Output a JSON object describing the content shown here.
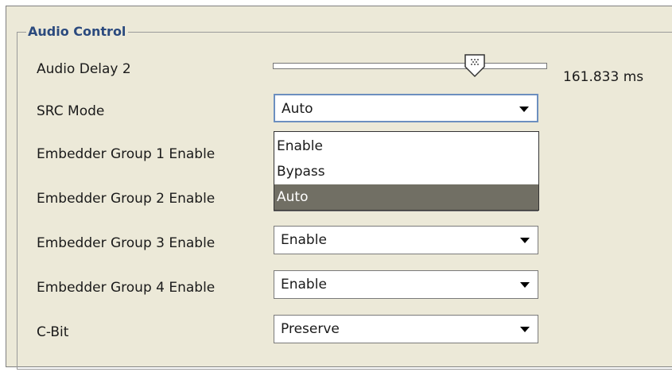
{
  "group_title": "Audio Control",
  "audio_delay": {
    "label": "Audio Delay 2",
    "value_text": "161.833 ms",
    "position": 0.73
  },
  "rows": [
    {
      "key": "src",
      "label": "SRC Mode",
      "value": "Auto"
    },
    {
      "key": "emb1",
      "label": "Embedder Group 1 Enable",
      "value": ""
    },
    {
      "key": "emb2",
      "label": "Embedder Group 2 Enable",
      "value": ""
    },
    {
      "key": "emb3",
      "label": "Embedder Group 3 Enable",
      "value": "Enable"
    },
    {
      "key": "emb4",
      "label": "Embedder Group 4 Enable",
      "value": "Enable"
    },
    {
      "key": "cbit",
      "label": "C-Bit",
      "value": "Preserve"
    }
  ],
  "src_dropdown_options": [
    "Enable",
    "Bypass",
    "Auto"
  ],
  "src_selected_option": "Auto",
  "colors": {
    "panel_bg": "#ece9d8",
    "selected_bg": "#716f64",
    "title_color": "#2b4a7e"
  }
}
